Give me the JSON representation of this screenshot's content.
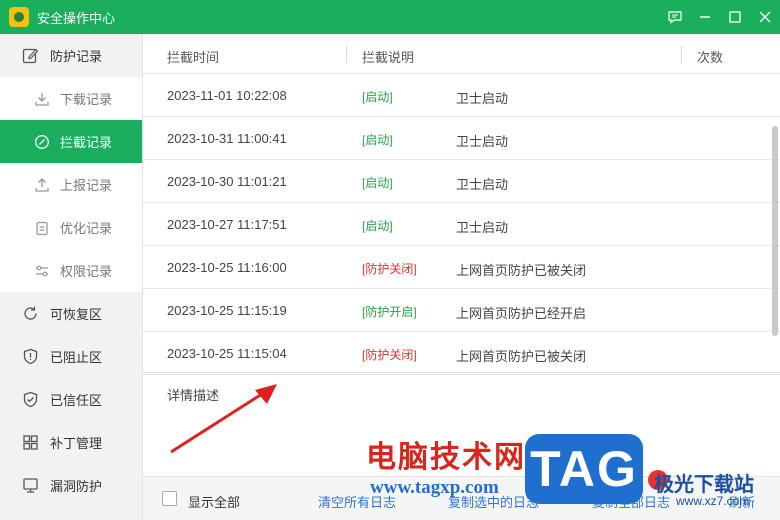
{
  "window": {
    "title": "安全操作中心"
  },
  "sidebar": {
    "group_protection": "防护记录",
    "sub_items": [
      {
        "label": "下载记录",
        "icon": "download-icon"
      },
      {
        "label": "拦截记录",
        "icon": "block-circle-icon",
        "active": true
      },
      {
        "label": "上报记录",
        "icon": "upload-icon"
      },
      {
        "label": "优化记录",
        "icon": "clipboard-icon"
      },
      {
        "label": "权限记录",
        "icon": "sliders-icon"
      }
    ],
    "groups": [
      {
        "label": "可恢复区",
        "icon": "restore-icon"
      },
      {
        "label": "已阻止区",
        "icon": "shield-alert-icon"
      },
      {
        "label": "已信任区",
        "icon": "shield-check-icon"
      },
      {
        "label": "补丁管理",
        "icon": "grid-icon"
      },
      {
        "label": "漏洞防护",
        "icon": "monitor-icon"
      }
    ]
  },
  "table": {
    "headers": {
      "time": "拦截时间",
      "desc": "拦截说明",
      "count": "次数"
    },
    "rows": [
      {
        "time": "2023-11-01 10:22:08",
        "status": "[启动]",
        "status_color": "#2aa14a",
        "desc": "卫士启动"
      },
      {
        "time": "2023-10-31 11:00:41",
        "status": "[启动]",
        "status_color": "#2aa14a",
        "desc": "卫士启动"
      },
      {
        "time": "2023-10-30 11:01:21",
        "status": "[启动]",
        "status_color": "#2aa14a",
        "desc": "卫士启动"
      },
      {
        "time": "2023-10-27 11:17:51",
        "status": "[启动]",
        "status_color": "#2aa14a",
        "desc": "卫士启动"
      },
      {
        "time": "2023-10-25 11:16:00",
        "status": "[防护关闭]",
        "status_color": "#e0322b",
        "desc": "上网首页防护已被关闭"
      },
      {
        "time": "2023-10-25 11:15:19",
        "status": "[防护开启]",
        "status_color": "#2aa14a",
        "desc": "上网首页防护已经开启"
      },
      {
        "time": "2023-10-25 11:15:04",
        "status": "[防护关闭]",
        "status_color": "#e0322b",
        "desc": "上网首页防护已被关闭"
      }
    ]
  },
  "detail": {
    "label": "详情描述"
  },
  "footer": {
    "show_all": "显示全部",
    "clear_all": "清空所有日志",
    "copy_selected": "复制选中的日志",
    "copy_all": "复制全部日志",
    "refresh": "刷新"
  },
  "watermark": {
    "cn": "电脑技术网",
    "url": "www.tagxp.com",
    "tag": "TAG",
    "site": "极光下载站",
    "site_url": "www.xz7.com"
  },
  "colors": {
    "accent": "#1aaf5d",
    "link": "#2f74d0"
  }
}
